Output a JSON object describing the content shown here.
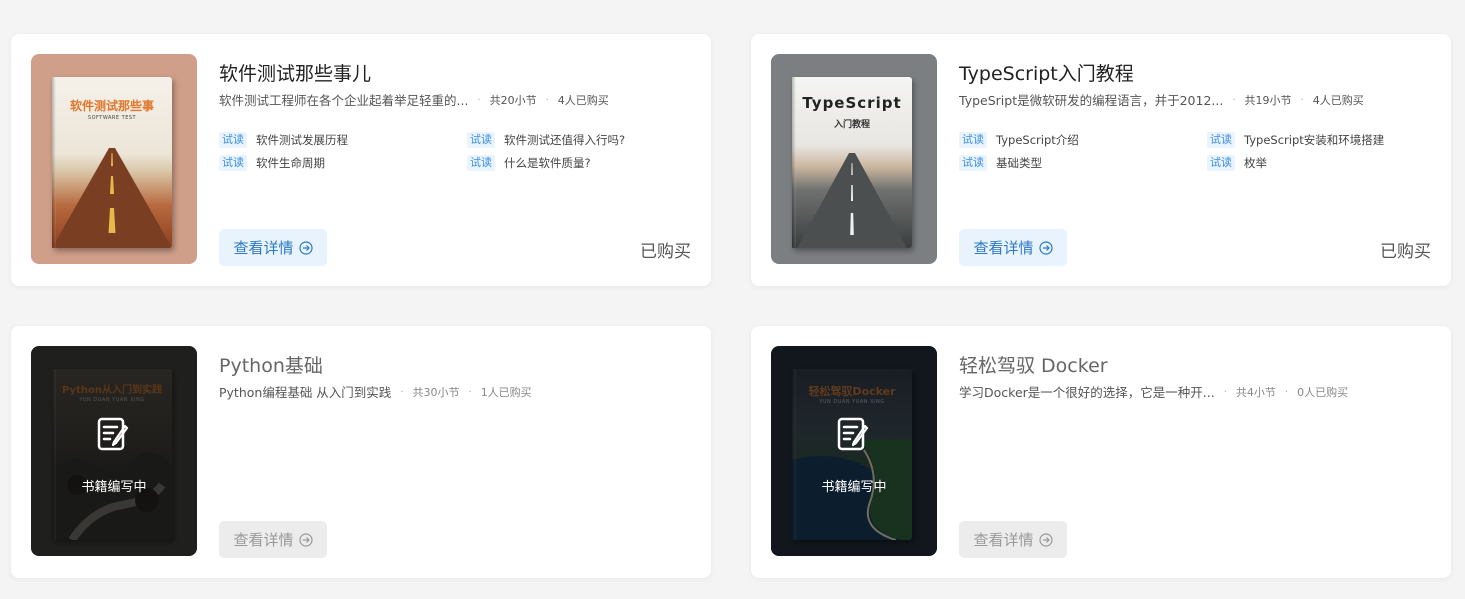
{
  "courses": [
    {
      "title": "软件测试那些事儿",
      "description": "软件测试工程师在各个企业起着举足轻重的...",
      "sections": "共20小节",
      "buyers": "4人已购买",
      "cover_title": "软件测试那些事",
      "cover_subtitle": "SOFTWARE TEST",
      "lessons": [
        {
          "tag": "试读",
          "label": "软件测试发展历程"
        },
        {
          "tag": "试读",
          "label": "软件测试还值得入行吗?"
        },
        {
          "tag": "试读",
          "label": "软件生命周期"
        },
        {
          "tag": "试读",
          "label": "什么是软件质量?"
        }
      ],
      "detail_label": "查看详情",
      "status": "已购买"
    },
    {
      "title": "TypeScript入门教程",
      "description": "TypeSript是微软研发的编程语言，并于2012...",
      "sections": "共19小节",
      "buyers": "4人已购买",
      "cover_title": "TypeScript",
      "cover_subtitle": "入门教程",
      "lessons": [
        {
          "tag": "试读",
          "label": "TypeScript介绍"
        },
        {
          "tag": "试读",
          "label": "TypeScript安装和环境搭建"
        },
        {
          "tag": "试读",
          "label": "基础类型"
        },
        {
          "tag": "试读",
          "label": "枚举"
        }
      ],
      "detail_label": "查看详情",
      "status": "已购买"
    },
    {
      "title": "Python基础",
      "description": "Python编程基础 从入门到实践",
      "sections": "共30小节",
      "buyers": "1人已购买",
      "cover_title": "Python从入门到实践",
      "cover_subtitle": "YUN DUAN YUAN XING",
      "overlay_label": "书籍编写中",
      "detail_label": "查看详情"
    },
    {
      "title": "轻松驾驭 Docker",
      "description": "学习Docker是一个很好的选择，它是一种开...",
      "sections": "共4小节",
      "buyers": "0人已购买",
      "cover_title": "轻松驾驭Docker",
      "cover_subtitle": "YUN DUAN YUAN XING",
      "overlay_label": "书籍编写中",
      "detail_label": "查看详情"
    }
  ],
  "colors": {
    "accent": "#3a8ee6",
    "detail_bg": "#e8f3fd",
    "disabled_bg": "#ececec"
  },
  "icons": {
    "overlay": "edit-document-icon",
    "detail_arrow": "arrow-circle-right-icon"
  }
}
